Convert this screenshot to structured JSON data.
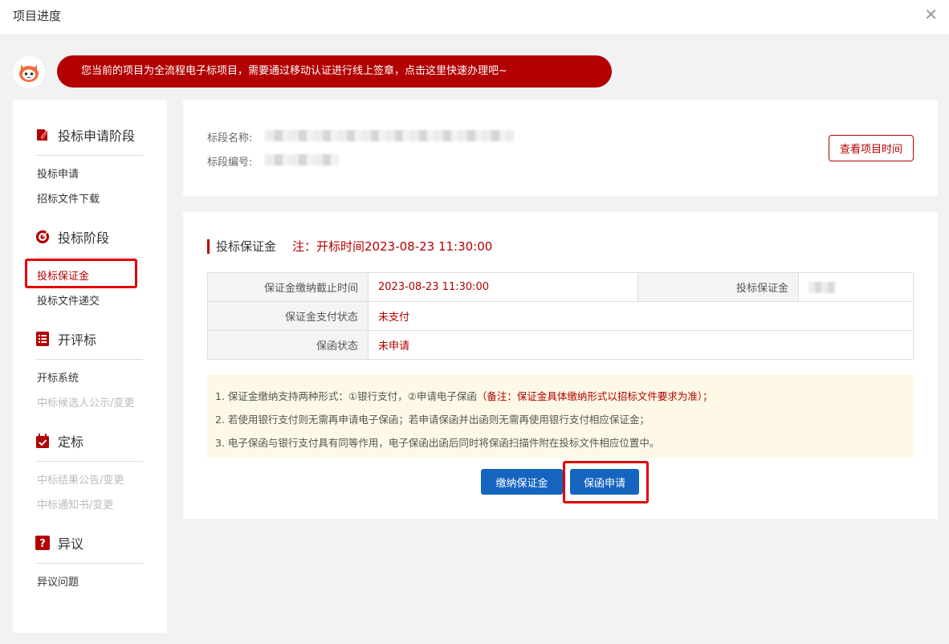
{
  "window": {
    "title": "项目进度",
    "close_icon": "close-icon"
  },
  "banner": {
    "text": "您当前的项目为全流程电子标项目，需要通过移动认证进行线上签章，点击这里快速办理吧~"
  },
  "sidebar": {
    "sections": [
      {
        "title": "投标申请阶段",
        "icon": "document-edit-icon",
        "items": [
          {
            "label": "投标申请"
          },
          {
            "label": "招标文件下载"
          }
        ]
      },
      {
        "title": "投标阶段",
        "icon": "target-icon",
        "items": [
          {
            "label": "投标保证金"
          },
          {
            "label": "投标文件递交"
          }
        ]
      },
      {
        "title": "开评标",
        "icon": "list-icon",
        "items": [
          {
            "label": "开标系统"
          },
          {
            "label": "中标候选人公示/变更"
          }
        ]
      },
      {
        "title": "定标",
        "icon": "calendar-check-icon",
        "items": [
          {
            "label": "中标结果公告/变更"
          },
          {
            "label": "中标通知书/变更"
          }
        ]
      },
      {
        "title": "异议",
        "icon": "question-icon",
        "items": [
          {
            "label": "异议问题"
          }
        ]
      }
    ]
  },
  "info_card": {
    "name_label": "标段名称:",
    "code_label": "标段编号:",
    "view_time_button": "查看项目时间"
  },
  "deposit": {
    "title": "投标保证金",
    "note": "注：开标时间2023-08-23 11:30:00",
    "rows": [
      {
        "k1": "保证金缴纳截止时间",
        "v1": "2023-08-23 11:30:00",
        "k2": "投标保证金"
      },
      {
        "k1": "保证金支付状态",
        "v1": "未支付"
      },
      {
        "k1": "保函状态",
        "v1": "未申请"
      }
    ],
    "notices": {
      "line1_a": "1. 保证金缴纳支持两种形式：①银行支付，②申请电子保函",
      "line1_b": "（备注：保证金具体缴纳形式以招标文件要求为准）；",
      "line2": "2. 若使用银行支付则无需再申请电子保函；若申请保函并出函则无需再使用银行支付相应保证金；",
      "line3": "3. 电子保函与银行支付具有同等作用，电子保函出函后同时将保函扫描件附在投标文件相应位置中。"
    },
    "pay_button": "缴纳保证金",
    "guarantee_button": "保函申请"
  },
  "colors": {
    "brand_red": "#b30000",
    "primary_blue": "#1565c0",
    "highlight_red": "#e00000"
  }
}
